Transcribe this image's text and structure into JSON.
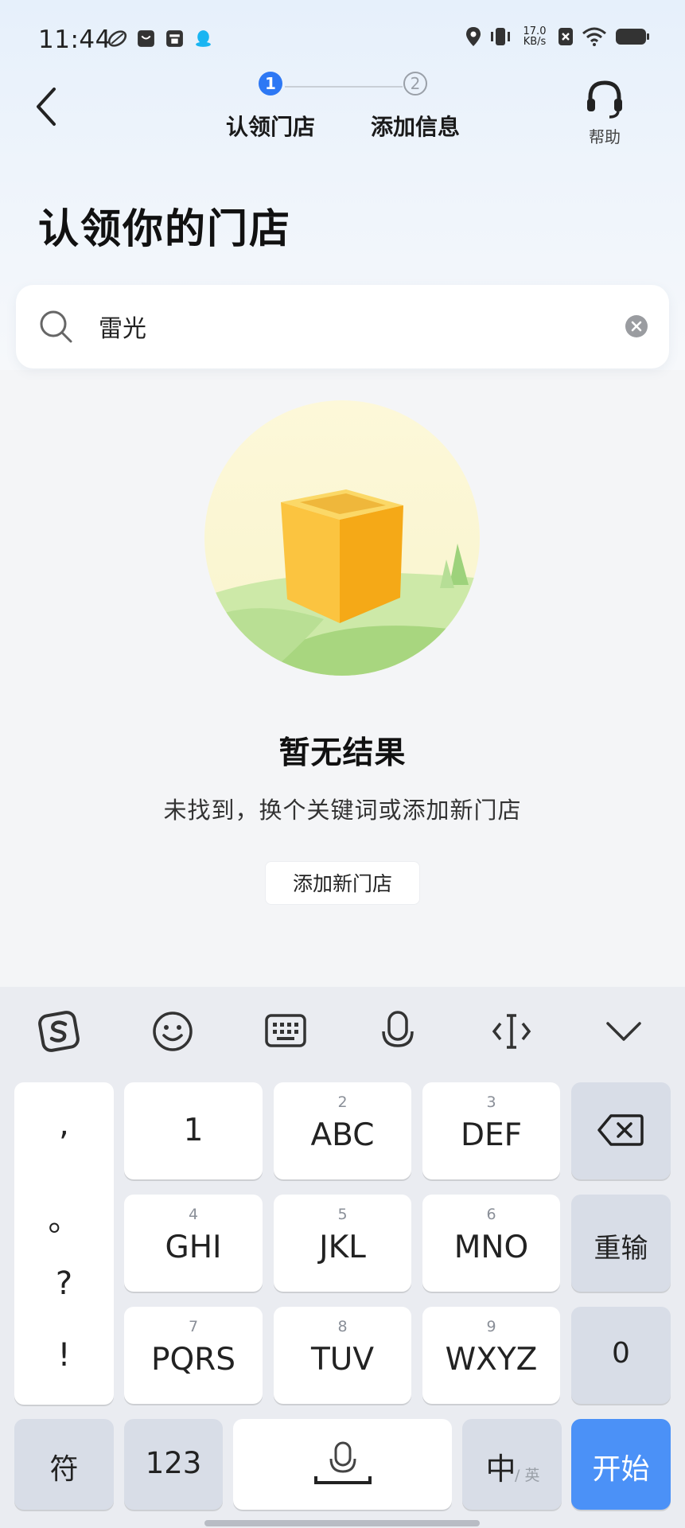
{
  "status_bar": {
    "time": "11:44",
    "net_speed_value": "17.0",
    "net_speed_unit": "KB/s"
  },
  "header": {
    "steps": [
      {
        "number": "1",
        "label": "认领门店",
        "active": true
      },
      {
        "number": "2",
        "label": "添加信息",
        "active": false
      }
    ],
    "help_label": "帮助"
  },
  "page_title": "认领你的门店",
  "search": {
    "value": "雷光"
  },
  "empty_state": {
    "title": "暂无结果",
    "description": "未找到，换个关键词或添加新门店",
    "button_label": "添加新门店"
  },
  "keyboard": {
    "toolbar_icons": [
      "sogou-logo-icon",
      "emoji-icon",
      "keyboard-icon",
      "microphone-icon",
      "cursor-icon",
      "collapse-icon"
    ],
    "punctuation": [
      ",",
      "。",
      "?",
      "!"
    ],
    "keys": {
      "k1": {
        "main": "1",
        "num": ""
      },
      "k2": {
        "main": "ABC",
        "num": "2"
      },
      "k3": {
        "main": "DEF",
        "num": "3"
      },
      "k4": {
        "main": "GHI",
        "num": "4"
      },
      "k5": {
        "main": "JKL",
        "num": "5"
      },
      "k6": {
        "main": "MNO",
        "num": "6"
      },
      "k7": {
        "main": "PQRS",
        "num": "7"
      },
      "k8": {
        "main": "TUV",
        "num": "8"
      },
      "k9": {
        "main": "WXYZ",
        "num": "9"
      }
    },
    "reenter_label": "重输",
    "zero_label": "0",
    "symbol_label": "符",
    "numbers_label": "123",
    "lang_primary": "中",
    "lang_secondary": "/ 英",
    "start_label": "开始"
  },
  "colors": {
    "accent_blue": "#2d78f4",
    "start_key_blue": "#4b91f7"
  }
}
